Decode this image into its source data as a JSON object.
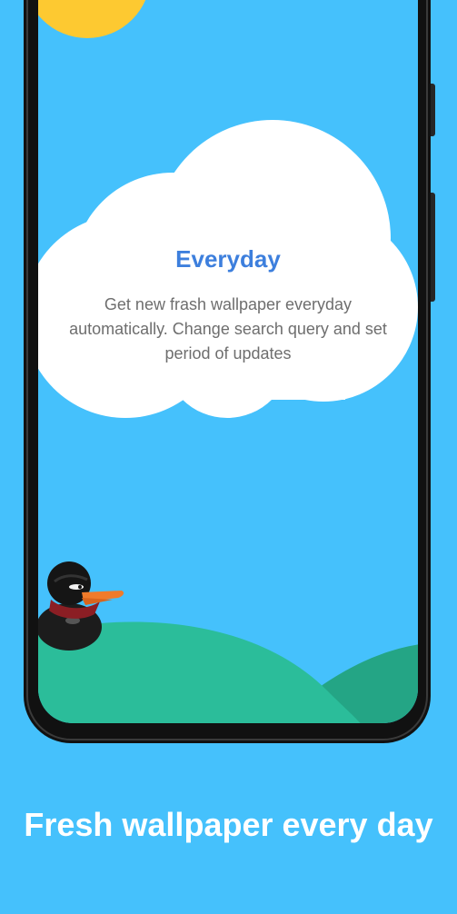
{
  "colors": {
    "background": "#45c1fc",
    "title": "#3d7fdd",
    "description": "#6e6e6e",
    "hill_front": "#2bbd9a",
    "hill_back": "#24a585",
    "sun": "#fdc931",
    "cloud": "#ffffff",
    "caption": "#ffffff"
  },
  "onboarding": {
    "title": "Everyday",
    "description": "Get new frash wallpaper everyday automatically. Change search query and set period of updates"
  },
  "caption": "Fresh wallpaper every day",
  "icons": [
    "sun-icon",
    "cloud-icon",
    "duck-character-icon"
  ]
}
